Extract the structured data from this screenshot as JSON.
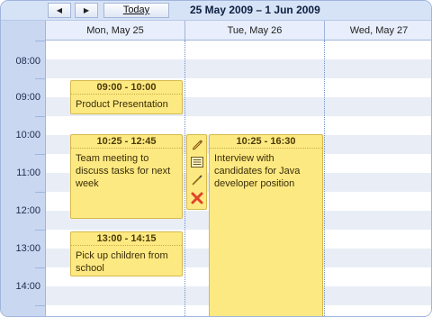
{
  "toolbar": {
    "prev_icon": "◀",
    "next_icon": "▶",
    "today_label": "Today",
    "date_range": "25 May 2009 – 1 Jun 2009"
  },
  "days": [
    "Mon, May 25",
    "Tue, May 26",
    "Wed, May 27"
  ],
  "hours": [
    "08:00",
    "09:00",
    "10:00",
    "11:00",
    "12:00",
    "13:00",
    "14:00"
  ],
  "events": [
    {
      "time": "09:00 - 10:00",
      "text": "Product Presentation"
    },
    {
      "time": "10:25 - 12:45",
      "text": "Team meeting to discuss tasks for next week"
    },
    {
      "time": "13:00 - 14:15",
      "text": "Pick up children from school"
    },
    {
      "time": "10:25 - 16:30",
      "text": "Interview with candidates for Java developer position"
    }
  ],
  "event_actions": [
    "edit-icon",
    "details-icon",
    "pen-icon",
    "delete-icon"
  ],
  "colors": {
    "accent": "#9fb5dc",
    "event_fill": "#fde981",
    "event_border": "#d7b94b",
    "delete": "#e0442b"
  }
}
